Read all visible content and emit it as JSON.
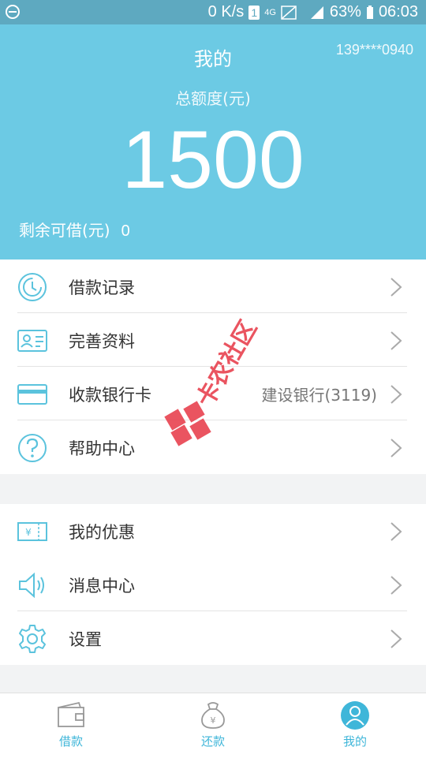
{
  "status_bar": {
    "speed": "0 K/s",
    "sim": "1",
    "network": "4G",
    "battery": "63%",
    "time": "06:03"
  },
  "header": {
    "title": "我的",
    "phone": "139****0940",
    "total_label": "总额度(元)",
    "total_amount": "1500",
    "remaining_label": "剩余可借(元)",
    "remaining_value": "0"
  },
  "menu_group_1": [
    {
      "label": "借款记录",
      "icon": "history-icon"
    },
    {
      "label": "完善资料",
      "icon": "id-card-icon"
    },
    {
      "label": "收款银行卡",
      "icon": "bank-card-icon",
      "value": "建设银行(3119)"
    },
    {
      "label": "帮助中心",
      "icon": "help-icon"
    }
  ],
  "menu_group_2": [
    {
      "label": "我的优惠",
      "icon": "coupon-icon"
    },
    {
      "label": "消息中心",
      "icon": "speaker-icon"
    },
    {
      "label": "设置",
      "icon": "gear-icon"
    }
  ],
  "watermark": "卡农社区",
  "tabs": [
    {
      "label": "借款",
      "icon": "wallet-icon"
    },
    {
      "label": "还款",
      "icon": "money-bag-icon"
    },
    {
      "label": "我的",
      "icon": "user-icon",
      "active": true
    }
  ],
  "colors": {
    "accent": "#6ccae4",
    "active_tab": "#3fb6d9",
    "inactive_tab": "#3fb6d9"
  }
}
